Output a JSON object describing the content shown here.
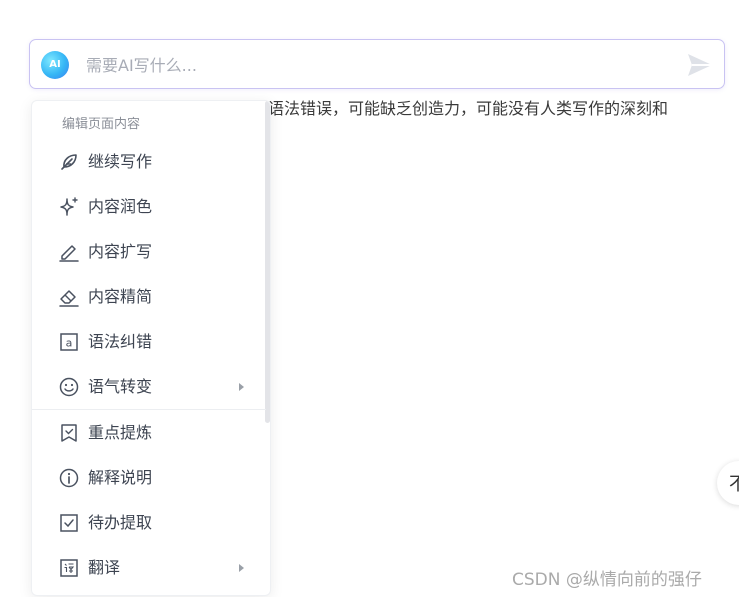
{
  "ai_bar": {
    "logo_text": "AI",
    "placeholder": "需要AI写什么...",
    "value": "",
    "send_icon": "send-icon"
  },
  "document": {
    "visible_text": "语法错误，可能缺乏创造力，可能没有人类写作的深刻和"
  },
  "menu": {
    "section_title": "编辑页面内容",
    "items": [
      {
        "label": "继续写作",
        "icon": "feather-icon",
        "has_submenu": false
      },
      {
        "label": "内容润色",
        "icon": "sparkle-icon",
        "has_submenu": false
      },
      {
        "label": "内容扩写",
        "icon": "pen-line-icon",
        "has_submenu": false
      },
      {
        "label": "内容精简",
        "icon": "eraser-icon",
        "has_submenu": false
      },
      {
        "label": "语法纠错",
        "icon": "letter-a-box-icon",
        "has_submenu": false
      },
      {
        "label": "语气转变",
        "icon": "smiley-icon",
        "has_submenu": true
      },
      {
        "label": "重点提炼",
        "icon": "bookmark-check-icon",
        "has_submenu": false
      },
      {
        "label": "解释说明",
        "icon": "info-circle-icon",
        "has_submenu": false
      },
      {
        "label": "待办提取",
        "icon": "checkbox-icon",
        "has_submenu": false
      },
      {
        "label": "翻译",
        "icon": "translate-icon",
        "has_submenu": true
      }
    ]
  },
  "float_button": {
    "text": "不"
  },
  "watermark": "CSDN @纵情向前的强仔",
  "colors": {
    "accent_border": "#c9c3f2",
    "menu_text": "#3d4451",
    "icon_color": "#4a5260"
  }
}
